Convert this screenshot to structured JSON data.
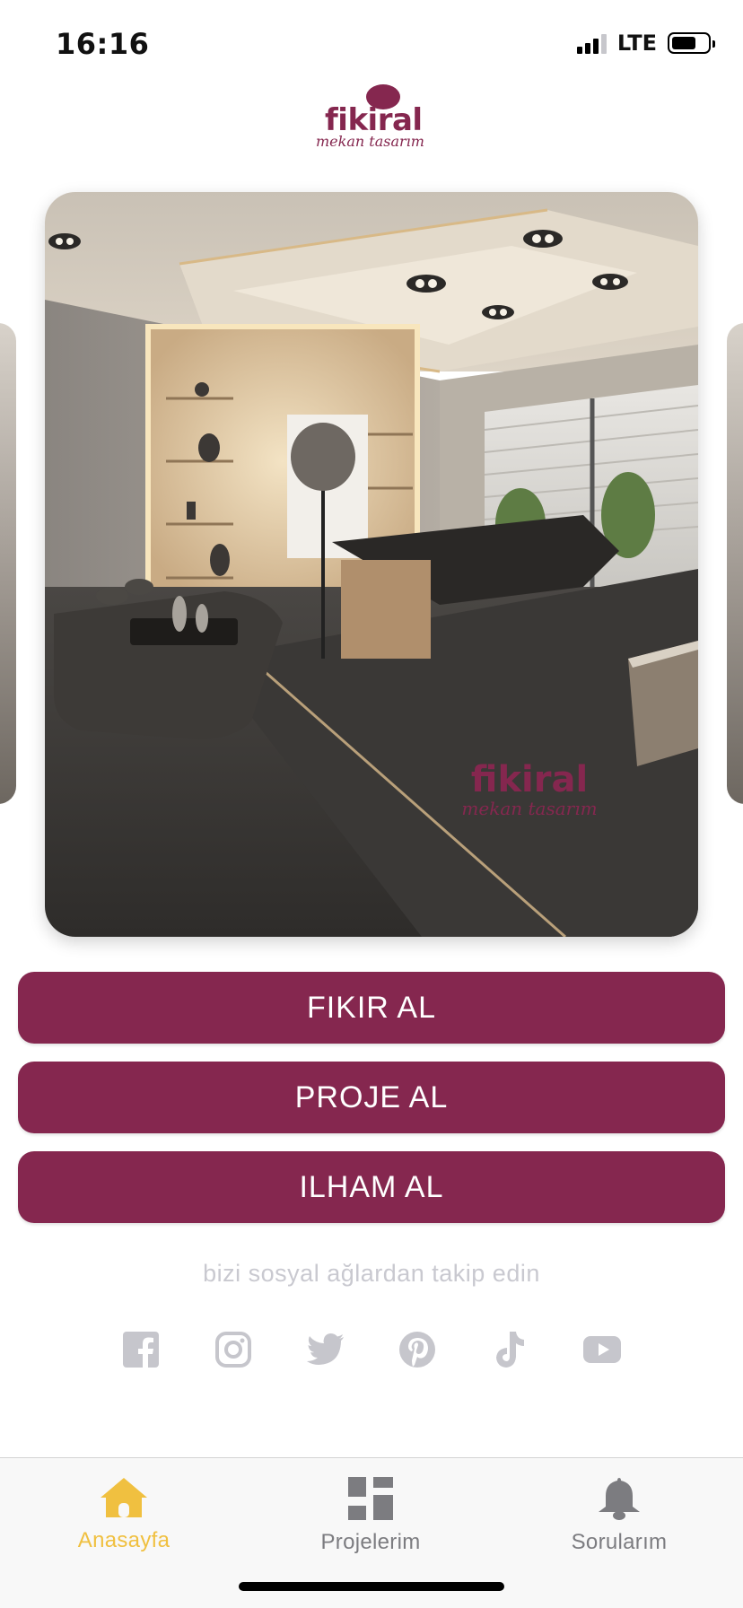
{
  "status_bar": {
    "time": "16:16",
    "network": "LTE"
  },
  "brand": {
    "name": "fikiral",
    "tagline": "mekan tasarım",
    "color": "#85274f"
  },
  "carousel": {
    "image_watermark_name": "fikiral",
    "image_watermark_tagline": "mekan tasarım"
  },
  "actions": [
    {
      "label": "FIKIR AL"
    },
    {
      "label": "PROJE AL"
    },
    {
      "label": "ILHAM AL"
    }
  ],
  "follow_text": "bizi sosyal ağlardan takip edin",
  "social_icons": [
    "facebook-icon",
    "instagram-icon",
    "twitter-icon",
    "pinterest-icon",
    "tiktok-icon",
    "youtube-icon"
  ],
  "tabbar": {
    "items": [
      {
        "label": "Anasayfa",
        "icon": "home-icon",
        "active": true
      },
      {
        "label": "Projelerim",
        "icon": "grid-icon",
        "active": false
      },
      {
        "label": "Sorularım",
        "icon": "bell-icon",
        "active": false
      }
    ],
    "active_color": "#f0c040",
    "inactive_color": "#7c7c80"
  }
}
